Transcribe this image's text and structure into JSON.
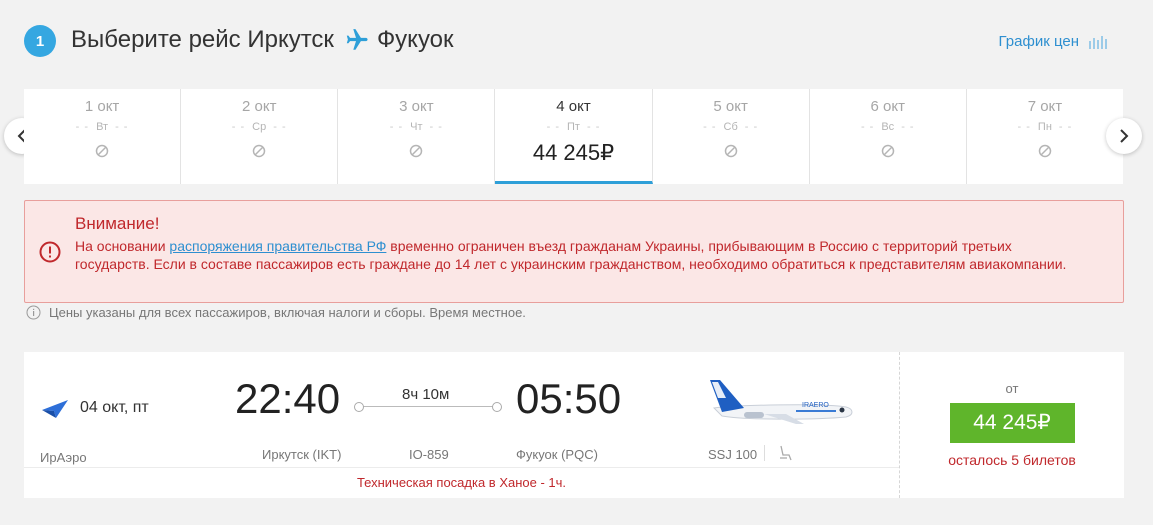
{
  "header": {
    "step": "1",
    "title_prefix": "Выберите рейс Иркутск",
    "destination": "Фукуок",
    "price_graph_label": "График цен"
  },
  "dates": [
    {
      "date": "1 окт",
      "weekday": "Вт",
      "price": null
    },
    {
      "date": "2 окт",
      "weekday": "Ср",
      "price": null
    },
    {
      "date": "3 окт",
      "weekday": "Чт",
      "price": null
    },
    {
      "date": "4 окт",
      "weekday": "Пт",
      "price": "44 245₽"
    },
    {
      "date": "5 окт",
      "weekday": "Сб",
      "price": null
    },
    {
      "date": "6 окт",
      "weekday": "Вс",
      "price": null
    },
    {
      "date": "7 окт",
      "weekday": "Пн",
      "price": null
    }
  ],
  "alert": {
    "title": "Внимание!",
    "text_before": "На основании ",
    "link_text": "распоряжения правительства РФ",
    "text_after": " временно ограничен въезд гражданам Украины, прибывающим в Россию с территорий третьих государств. Если в составе пассажиров есть граждане до 14 лет с украинским гражданством, необходимо обратиться к представителям авиакомпании."
  },
  "note": "Цены указаны для всех пассажиров, включая налоги и сборы. Время местное.",
  "flight": {
    "date": "04 окт, пт",
    "airline": "ИрАэро",
    "departure_time": "22:40",
    "arrival_time": "05:50",
    "duration": "8ч 10м",
    "departure_airport": "Иркутск (IKT)",
    "flight_number": "IO-859",
    "arrival_airport": "Фукуок (PQC)",
    "aircraft": "SSJ 100",
    "technical_stop": "Техническая посадка в Ханое - 1ч.",
    "price_from": "от",
    "price": "44 245₽",
    "tickets_left": "осталось 5 билетов"
  },
  "colors": {
    "accent_blue": "#35a7e1",
    "price_green": "#5fb52b",
    "alert_red": "#c0282c"
  }
}
